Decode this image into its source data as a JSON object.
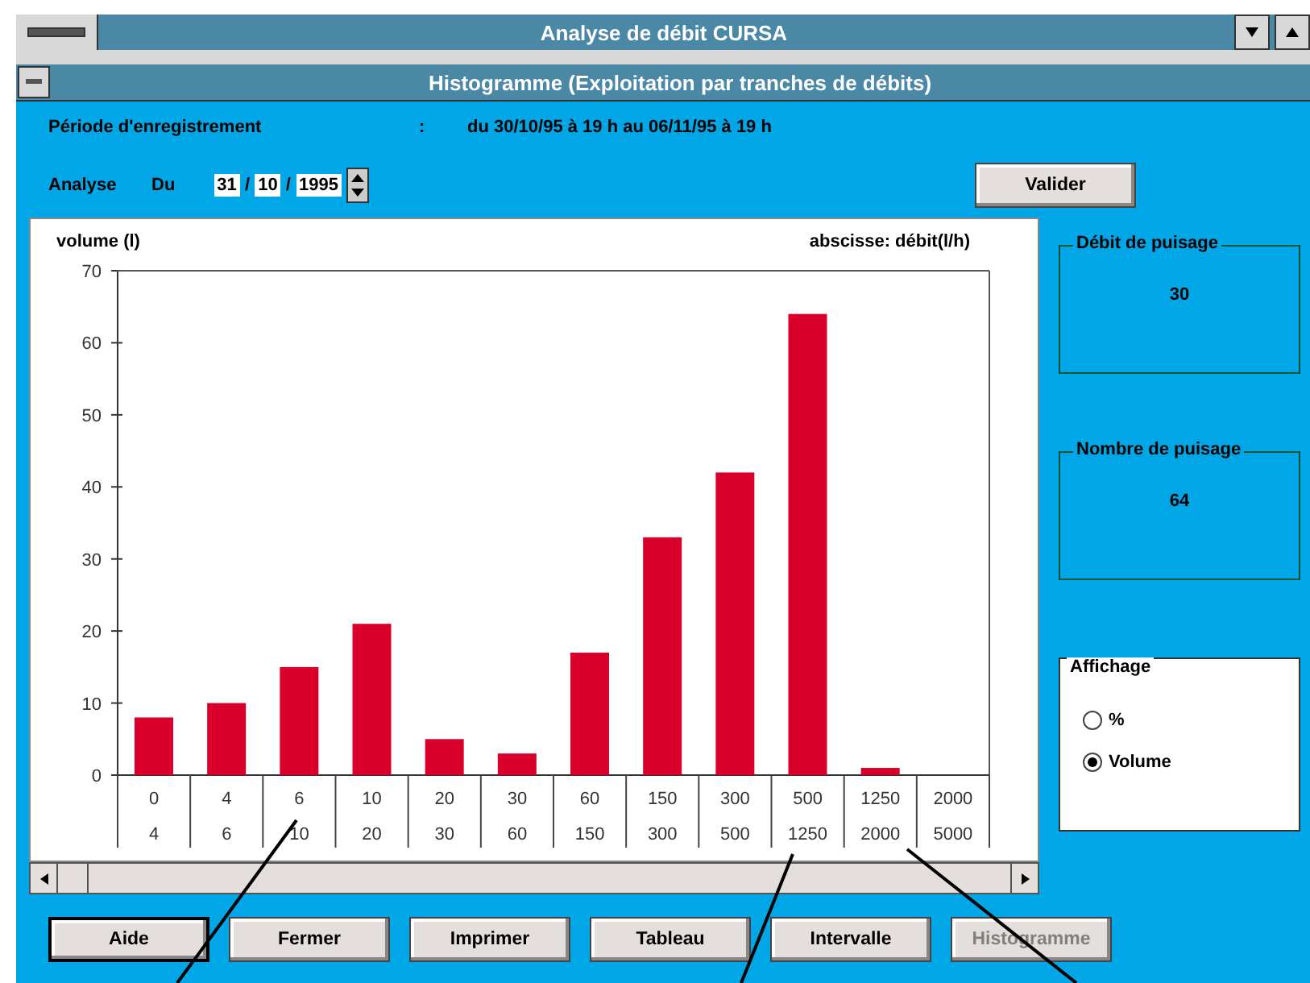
{
  "window": {
    "title": "Analyse de débit CURSA"
  },
  "subwindow": {
    "title": "Histogramme (Exploitation par tranches de débits)"
  },
  "period": {
    "label": "Période d'enregistrement",
    "separator": ":",
    "value": "du 30/10/95 à 19 h au 06/11/95 à 19 h"
  },
  "analysis": {
    "label": "Analyse",
    "from_label": "Du",
    "day": "31",
    "month": "10",
    "year": "1995",
    "date_separator": "/",
    "validate_button": "Valider"
  },
  "chart": {
    "chart_data": {
      "type": "bar",
      "ylabel": "volume (l)",
      "xlabel": "abscisse: débit(l/h)",
      "categories": [
        "0",
        "4",
        "6",
        "10",
        "20",
        "30",
        "60",
        "150",
        "300",
        "500",
        "1250",
        "2000"
      ],
      "series": [
        {
          "color": "#d8002a",
          "values": [
            8,
            10,
            15,
            21,
            5,
            3,
            17,
            33,
            42,
            64,
            1,
            0
          ]
        }
      ],
      "ylim": [
        0,
        70
      ],
      "yticks": [
        0,
        10,
        20,
        30,
        40,
        50,
        60,
        70
      ]
    },
    "upper_bounds": [
      "4",
      "6",
      "10",
      "20",
      "30",
      "60",
      "150",
      "300",
      "500",
      "1250",
      "2000",
      "5000"
    ]
  },
  "stats": [
    {
      "label": "Débit de puisage",
      "value": "30"
    },
    {
      "label": "Nombre de puisage",
      "value": "64"
    }
  ],
  "display": {
    "label": "Affichage",
    "options": [
      {
        "label": "%",
        "selected": false
      },
      {
        "label": "Volume",
        "selected": true
      }
    ]
  },
  "buttons": [
    {
      "label": "Aide",
      "default": true,
      "disabled": false
    },
    {
      "label": "Fermer",
      "default": false,
      "disabled": false
    },
    {
      "label": "Imprimer",
      "default": false,
      "disabled": false
    },
    {
      "label": "Tableau",
      "default": false,
      "disabled": false
    },
    {
      "label": "Intervalle",
      "default": false,
      "disabled": false
    },
    {
      "label": "Histogramme",
      "default": false,
      "disabled": true
    }
  ]
}
